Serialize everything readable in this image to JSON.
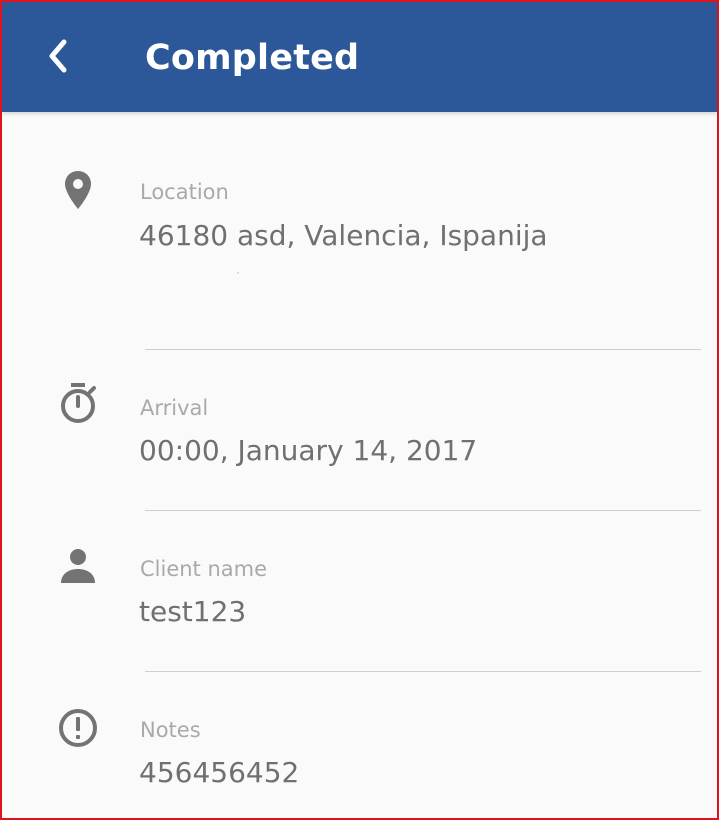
{
  "header": {
    "title": "Completed",
    "back_icon": "chevron-left-icon",
    "background_color": "#2c5899"
  },
  "details": {
    "location": {
      "icon": "location-pin-icon",
      "label": "Location",
      "value": "46180 asd, Valencia, Ispanija"
    },
    "arrival": {
      "icon": "stopwatch-icon",
      "label": "Arrival",
      "value": "00:00, January 14, 2017"
    },
    "client": {
      "icon": "person-icon",
      "label": "Client name",
      "value": "test123"
    },
    "notes": {
      "icon": "alert-circle-icon",
      "label": "Notes",
      "value": "456456452"
    }
  }
}
